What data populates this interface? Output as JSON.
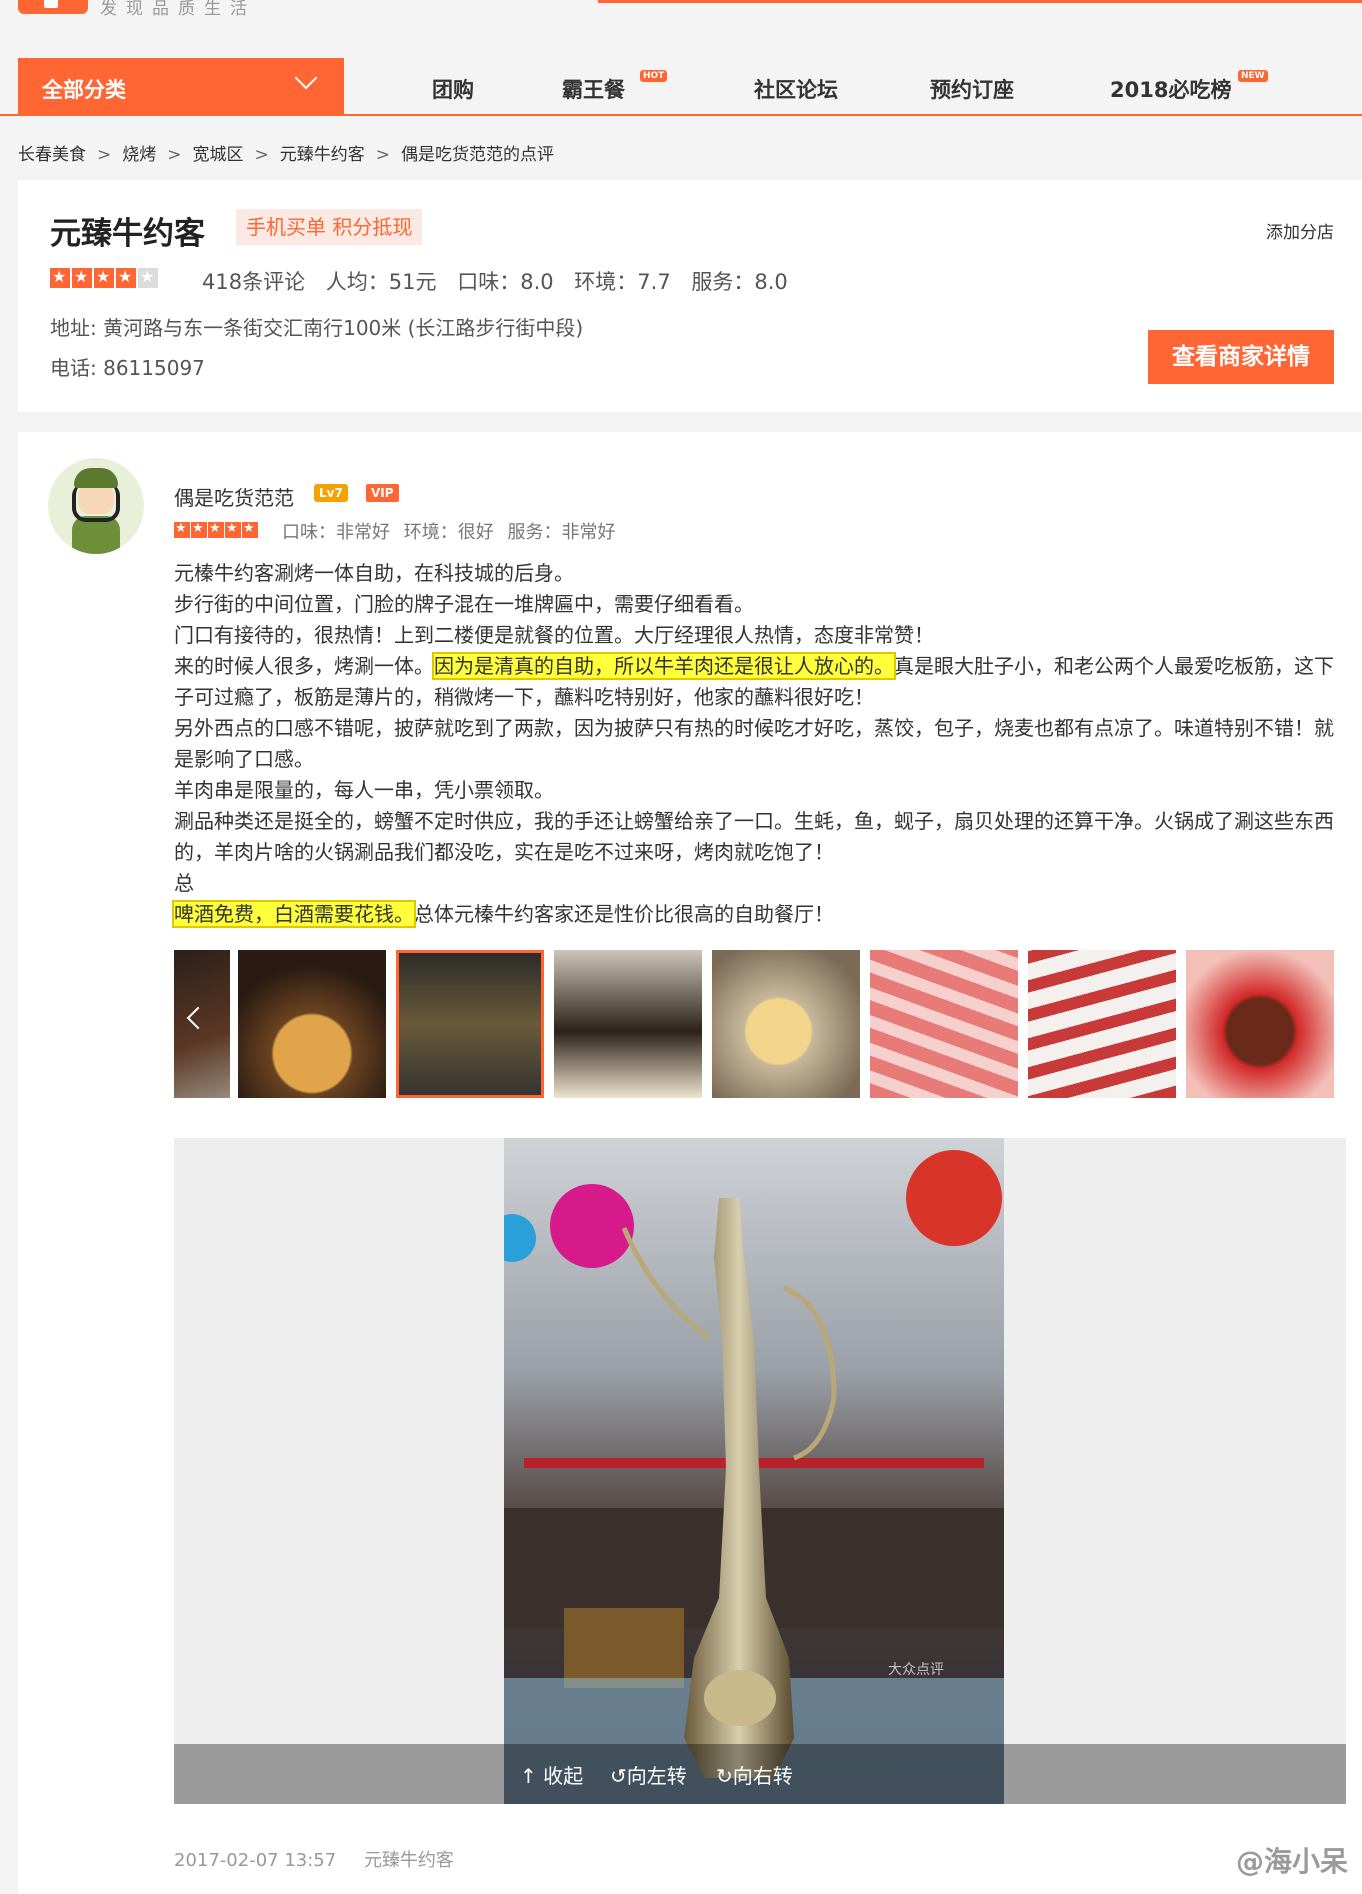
{
  "header": {
    "slogan": "发现品质生活",
    "category_button": "全部分类",
    "nav": [
      {
        "label": "团购",
        "badge": ""
      },
      {
        "label": "霸王餐",
        "badge": "HOT"
      },
      {
        "label": "社区论坛",
        "badge": ""
      },
      {
        "label": "预约订座",
        "badge": ""
      },
      {
        "label": "2018必吃榜",
        "badge": "NEW"
      }
    ]
  },
  "breadcrumb": [
    "长春美食",
    "烧烤",
    "宽城区",
    "元臻牛约客",
    "偶是吃货范范的点评"
  ],
  "breadcrumb_sep": ">",
  "shop": {
    "name": "元臻牛约客",
    "promo": "手机买单 积分抵现",
    "add_branch": "添加分店",
    "star_rating": 4,
    "review_count": "418条评论",
    "avg_price": "人均：51元",
    "taste": "口味：8.0",
    "environment": "环境：7.7",
    "service": "服务：8.0",
    "address": "地址: 黄河路与东一条街交汇南行100米 (长江路步行街中段)",
    "phone": "电话: 86115097",
    "detail_button": "查看商家详情"
  },
  "review": {
    "user_name": "偶是吃货范范",
    "level": "Lv7",
    "vip": "VIP",
    "star_rating": 5,
    "taste": "口味：非常好",
    "environment": "环境：很好",
    "service": "服务：非常好",
    "line1": "元榛牛约客涮烤一体自助，在科技城的后身。",
    "line2": "步行街的中间位置，门脸的牌子混在一堆牌匾中，需要仔细看看。",
    "line3": "门口有接待的，很热情！上到二楼便是就餐的位置。大厅经理很人热情，态度非常赞！",
    "line4_a": "来的时候人很多，烤涮一体。",
    "line4_hl": "因为是清真的自助，所以牛羊肉还是很让人放心的。",
    "line4_b": "真是眼大肚子小，和老公两个人最爱吃板筋，这下子可过瘾了，板筋是薄片的，稍微烤一下，蘸料吃特别好，他家的蘸料很好吃！",
    "line5": "另外西点的口感不错呢，披萨就吃到了两款，因为披萨只有热的时候吃才好吃，蒸饺，包子，烧麦也都有点凉了。味道特别不错！就是影响了口感。",
    "line6": "羊肉串是限量的，每人一串，凭小票领取。",
    "line7": "涮品种类还是挺全的，螃蟹不定时供应，我的手还让螃蟹给亲了一口。生蚝，鱼，蚬子，扇贝处理的还算干净。火锅成了涮这些东西的，羊肉片啥的火锅涮品我们都没吃，实在是吃不过来呀，烤肉就吃饱了！",
    "line8": "总",
    "line9_hl": "啤酒免费，白酒需要花钱。",
    "line9_b": "总体元榛牛约客家还是性价比很高的自助餐厅！",
    "date": "2017-02-07 13:57",
    "shop_link": "元臻牛约客"
  },
  "viewer": {
    "collapse": "收起",
    "rotate_left": "向左转",
    "rotate_right": "向右转",
    "photo_watermark": "大众点评"
  },
  "watermark": "@海小呆"
}
